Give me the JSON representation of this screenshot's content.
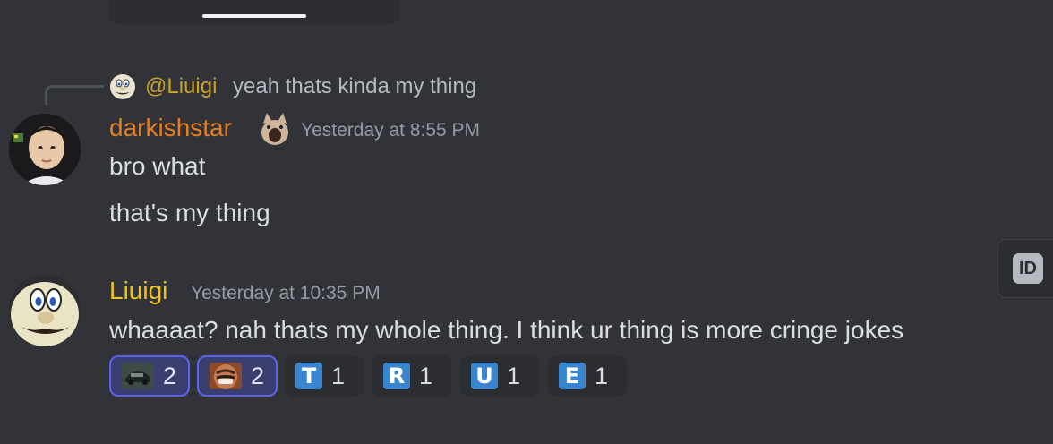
{
  "reply": {
    "mention": "@Liuigi",
    "text": "yeah thats kinda my thing"
  },
  "messages": [
    {
      "username": "darkishstar",
      "username_color": "#e67e22",
      "badge_icon": "screaming-cat-emoji",
      "timestamp": "Yesterday at 8:55 PM",
      "lines": [
        "bro what",
        "that's my thing"
      ]
    },
    {
      "username": "Liuigi",
      "username_color": "#f0c419",
      "timestamp": "Yesterday at 10:35 PM",
      "lines": [
        "whaaaat? nah thats my whole thing. I think ur thing is more cringe jokes"
      ],
      "reactions": [
        {
          "emoji": "car-emoji",
          "count": "2",
          "selected": true
        },
        {
          "emoji": "laughing-man-emoji",
          "count": "2",
          "selected": true
        },
        {
          "emoji": "T",
          "count": "1",
          "selected": false
        },
        {
          "emoji": "R",
          "count": "1",
          "selected": false
        },
        {
          "emoji": "U",
          "count": "1",
          "selected": false
        },
        {
          "emoji": "E",
          "count": "1",
          "selected": false
        }
      ]
    }
  ],
  "side_tab": {
    "label": "ID"
  },
  "colors": {
    "background": "#313338",
    "reaction_selected_border": "#5865f2",
    "letter_emoji_blue": "#3a85cf"
  }
}
